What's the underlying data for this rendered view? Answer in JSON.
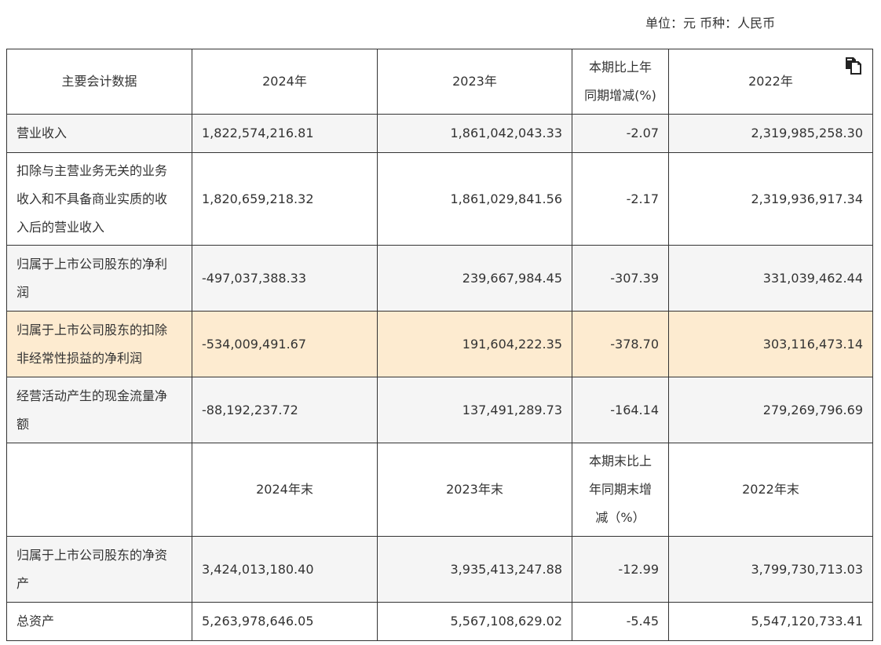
{
  "unit_text": "单位：元 币种：人民币",
  "header1": {
    "label": "主要会计数据",
    "y2024": "2024年",
    "y2023": "2023年",
    "change_line1": "本期比上年",
    "change_line2": "同期增减(%)",
    "y2022": "2022年"
  },
  "rows1": [
    {
      "label": "营业收入",
      "y2024": "1,822,574,216.81",
      "y2023": "1,861,042,043.33",
      "change": "-2.07",
      "y2022": "2,319,985,258.30"
    },
    {
      "label_lines": [
        "扣除与主营业务无关的业务",
        "收入和不具备商业实质的收",
        "入后的营业收入"
      ],
      "y2024": "1,820,659,218.32",
      "y2023": "1,861,029,841.56",
      "change": "-2.17",
      "y2022": "2,319,936,917.34"
    },
    {
      "label_lines": [
        "归属于上市公司股东的净利",
        "润"
      ],
      "y2024": "-497,037,388.33",
      "y2023": "239,667,984.45",
      "change": "-307.39",
      "y2022": "331,039,462.44"
    },
    {
      "label_lines": [
        "归属于上市公司股东的扣除",
        "非经常性损益的净利润"
      ],
      "y2024": "-534,009,491.67",
      "y2023": "191,604,222.35",
      "change": "-378.70",
      "y2022": "303,116,473.14"
    },
    {
      "label_lines": [
        "经营活动产生的现金流量净",
        "额"
      ],
      "y2024": "-88,192,237.72",
      "y2023": "137,491,289.73",
      "change": "-164.14",
      "y2022": "279,269,796.69"
    }
  ],
  "header2": {
    "label": "",
    "y2024": "2024年末",
    "y2023": "2023年末",
    "change_line1": "本期末比上",
    "change_line2": "年同期末增",
    "change_line3": "减（%）",
    "y2022": "2022年末"
  },
  "rows2": [
    {
      "label_lines": [
        "归属于上市公司股东的净资",
        "产"
      ],
      "y2024": "3,424,013,180.40",
      "y2023": "3,935,413,247.88",
      "change": "-12.99",
      "y2022": "3,799,730,713.03"
    },
    {
      "label": "总资产",
      "y2024": "5,263,978,646.05",
      "y2023": "5,567,108,629.02",
      "change": "-5.45",
      "y2022": "5,547,120,733.41"
    }
  ],
  "colors": {
    "border": "#333333",
    "row_alt": "#f5f5f5",
    "row_highlight": "#fdebd0",
    "text": "#333333"
  },
  "icons": {
    "copy": "copy-icon"
  }
}
